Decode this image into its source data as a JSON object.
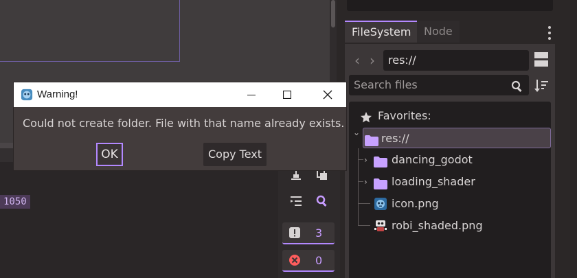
{
  "dialog": {
    "title": "Warning!",
    "message": "Could not create folder. File with that name already exists.",
    "ok_label": "OK",
    "copy_label": "Copy Text"
  },
  "editor": {
    "code_value": "1050"
  },
  "counters": {
    "warnings": "3",
    "errors": "0"
  },
  "dock": {
    "tabs": [
      {
        "label": "FileSystem",
        "active": true
      },
      {
        "label": "Node",
        "active": false
      }
    ],
    "path": "res://",
    "search_placeholder": "Search files"
  },
  "tree": {
    "favorites_label": "Favorites:",
    "root_label": "res://",
    "items": [
      {
        "label": "dancing_godot",
        "icon": "folder-icon"
      },
      {
        "label": "loading_shader",
        "icon": "folder-icon"
      },
      {
        "label": "icon.png",
        "icon": "godot-icon"
      },
      {
        "label": "robi_shaded.png",
        "icon": "robot-image-icon"
      }
    ]
  },
  "colors": {
    "accent": "#b388ff",
    "folder": "#c7a1ff",
    "panel": "#3c3738",
    "background": "#2b2727"
  }
}
